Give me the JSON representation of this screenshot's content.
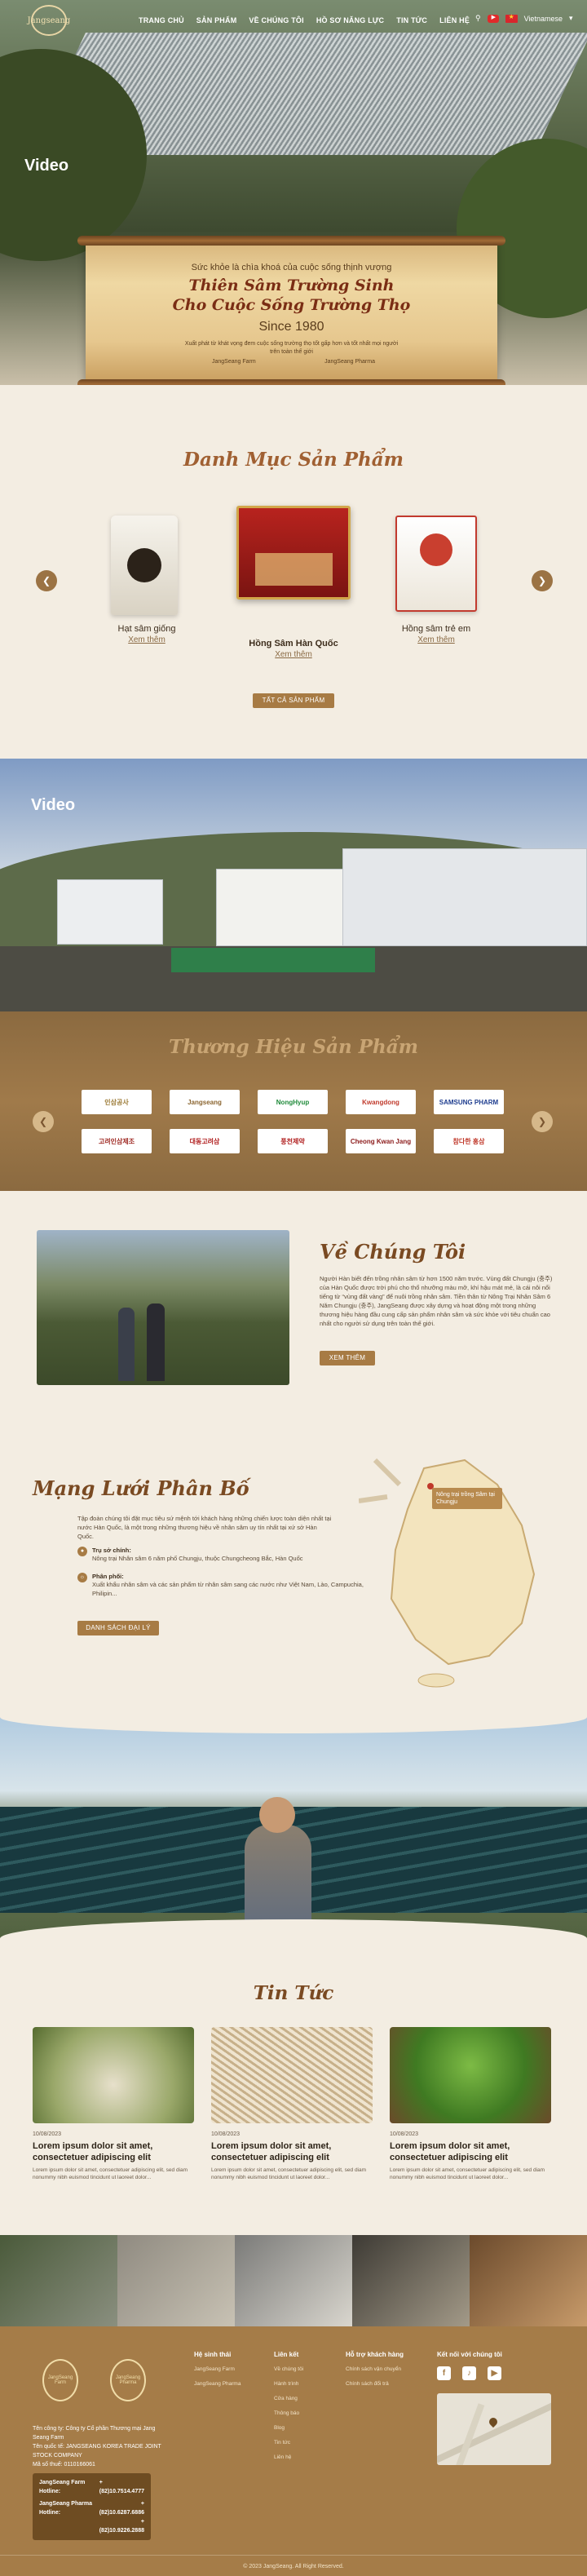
{
  "nav": {
    "logo": "Jangseang",
    "items": [
      "TRANG CHỦ",
      "SẢN PHẨM",
      "VỀ CHÚNG TÔI",
      "HỒ SƠ NĂNG LỰC",
      "TIN TỨC",
      "LIÊN HỆ"
    ],
    "language": "Vietnamese"
  },
  "hero": {
    "video_label": "Video",
    "subtitle": "Sức khỏe là chìa khoá của cuộc sống thịnh vượng",
    "title_line1": "Thiên Sâm Trường Sinh",
    "title_line2": "Cho Cuộc Sống Trường Thọ",
    "since": "Since 1980",
    "desc": "Xuất phát từ khát vọng đem cuộc sống trường thọ tốt gấp hơn và tốt nhất mọi người trên toàn thế giới",
    "link1": "JangSeang Farm",
    "link2": "JangSeang Pharma"
  },
  "products": {
    "heading": "Danh Mục Sản Phẩm",
    "items": [
      {
        "name": "Hạt sâm giống",
        "more": "Xem thêm"
      },
      {
        "name": "Hồng Sâm Hàn Quốc",
        "more": "Xem thêm"
      },
      {
        "name": "Hồng sâm trẻ em",
        "more": "Xem thêm"
      }
    ],
    "button": "TẤT CẢ SẢN PHẨM"
  },
  "factory": {
    "video_label": "Video"
  },
  "brands": {
    "heading": "Thương Hiệu Sản Phẩm",
    "row1": [
      "인삼공사",
      "Jangseang",
      "NongHyup",
      "Kwangdong",
      "SAMSUNG PHARM"
    ],
    "row2": [
      "고려인삼제조",
      "대동고려삼",
      "풍천제약",
      "Cheong Kwan Jang",
      "참다한 홍삼"
    ]
  },
  "about": {
    "heading": "Về Chúng Tôi",
    "text": "Người Hàn biết đến trồng nhân sâm từ hơn 1500 năm trước. Vùng đất Chungju (충주) của Hàn Quốc được trời phú cho thổ nhưỡng màu mỡ, khí hậu mát mẻ, là cái nôi nổi tiếng từ “vùng đất vàng” để nuôi trồng nhân sâm. Tiền thân từ Nông Trại Nhân Sâm 6 Năm Chungju (충주), JangSeang được xây dựng và hoạt động một trong những thương hiệu hàng đầu cung cấp sản phẩm nhân sâm và sức khỏe với tiêu chuẩn cao nhất cho người sử dụng trên toàn thế giới.",
    "button": "XEM THÊM"
  },
  "distribution": {
    "heading": "Mạng Lưới Phân Bố",
    "intro": "Tập đoàn chúng tôi đặt mục tiêu sứ mệnh tới khách hàng những chiến lược toàn diện nhất tại nước Hàn Quốc, là một trong những thương hiệu về nhân sâm uy tín nhất tại xứ sở Hàn Quốc.",
    "headquarter_title": "Trụ sở chính:",
    "headquarter_text": "Nông trại Nhân sâm 6 năm phố Chungju, thuộc Chungcheong Bắc, Hàn Quốc",
    "distribution_title": "Phân phối:",
    "distribution_text": "Xuất khẩu nhân sâm và các sản phẩm từ nhân sâm sang các nước như Việt Nam, Lào, Campuchia, Philipin...",
    "button": "DANH SÁCH ĐẠI LÝ",
    "map_label": "Nông trại trồng Sâm tại Chungju"
  },
  "news": {
    "heading": "Tin Tức",
    "items": [
      {
        "date": "10/08/2023",
        "title": "Lorem ipsum dolor sit amet, consectetuer adipiscing elit",
        "desc": "Lorem ipsum dolor sit amet, consectetuer adipiscing elit, sed diam nonummy nibh euismod tincidunt ut laoreet dolor..."
      },
      {
        "date": "10/08/2023",
        "title": "Lorem ipsum dolor sit amet, consectetuer adipiscing elit",
        "desc": "Lorem ipsum dolor sit amet, consectetuer adipiscing elit, sed diam nonummy nibh euismod tincidunt ut laoreet dolor..."
      },
      {
        "date": "10/08/2023",
        "title": "Lorem ipsum dolor sit amet, consectetuer adipiscing elit",
        "desc": "Lorem ipsum dolor sit amet, consectetuer adipiscing elit, sed diam nonummy nibh euismod tincidunt ut laoreet dolor..."
      }
    ]
  },
  "footer": {
    "logo1": "JangSeang Farm",
    "logo2": "JangSeang Pharma",
    "company": "Tên công ty: Công ty Cổ phần Thương mại Jang Seang Farm",
    "company2": "Tên quốc tế: JANGSEANG KOREA TRADE JOINT STOCK COMPANY",
    "tax": "Mã số thuế: 0110166061",
    "hotline_farm_label": "JangSeang Farm Hotline:",
    "hotline_farm": "+(82)10.7514.4777",
    "hotline_pharma_label": "JangSeang Pharma Hotline:",
    "hotline_pharma": "+(82)10.6287.6886 +(82)10.9226.2888",
    "col1_title": "Hệ sinh thái",
    "col1": [
      "JangSeang Farm",
      "JangSeang Pharma"
    ],
    "col2_title": "Liên kết",
    "col2": [
      "Về chúng tôi",
      "Hành trình",
      "Cửa hàng",
      "Thông báo",
      "Blog",
      "Tin tức",
      "Liên hệ"
    ],
    "col3_title": "Hỗ trợ khách hàng",
    "col3": [
      "Chính sách vận chuyển",
      "Chính sách đổi trả"
    ],
    "col4_title": "Kết nối với chúng tôi",
    "copyright": "© 2023 JangSeang. All Right Reserved."
  }
}
